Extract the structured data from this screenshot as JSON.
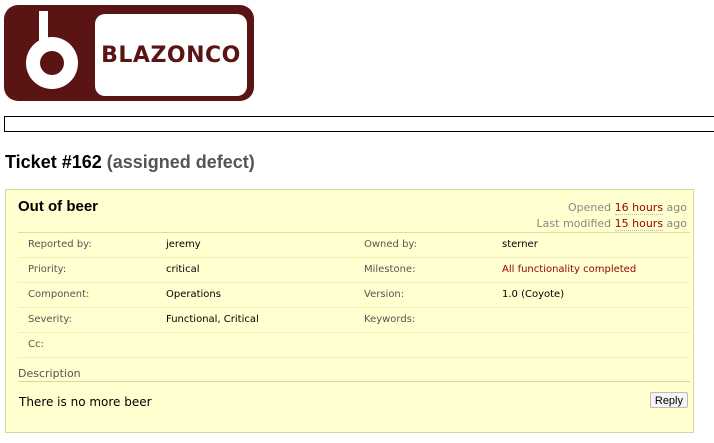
{
  "logo": {
    "brand_text": "BLAZONCO",
    "icon": "b-logo-icon",
    "color": "#5a1414"
  },
  "ticket": {
    "heading": "Ticket #162",
    "status": "(assigned defect)",
    "summary": "Out of beer",
    "opened_label": "Opened",
    "opened_ago": "16 hours",
    "modified_label": "Last modified",
    "modified_ago": "15 hours",
    "ago_suffix": "ago",
    "properties": [
      {
        "label": "Reported by:",
        "value": "jeremy",
        "label2": "Owned by:",
        "value2": "sterner"
      },
      {
        "label": "Priority:",
        "value": "critical",
        "label2": "Milestone:",
        "value2": "All functionality completed"
      },
      {
        "label": "Component:",
        "value": "Operations",
        "label2": "Version:",
        "value2": "1.0 (Coyote)"
      },
      {
        "label": "Severity:",
        "value": "Functional, Critical",
        "label2": "Keywords:",
        "value2": ""
      },
      {
        "label": "Cc:",
        "value": ""
      }
    ],
    "description_heading": "Description",
    "description": "There is no more beer",
    "reply_label": "Reply"
  },
  "colors": {
    "link": "#990000",
    "ticket_bg": "#ffffd0",
    "ticket_border": "#d7d7a0"
  }
}
